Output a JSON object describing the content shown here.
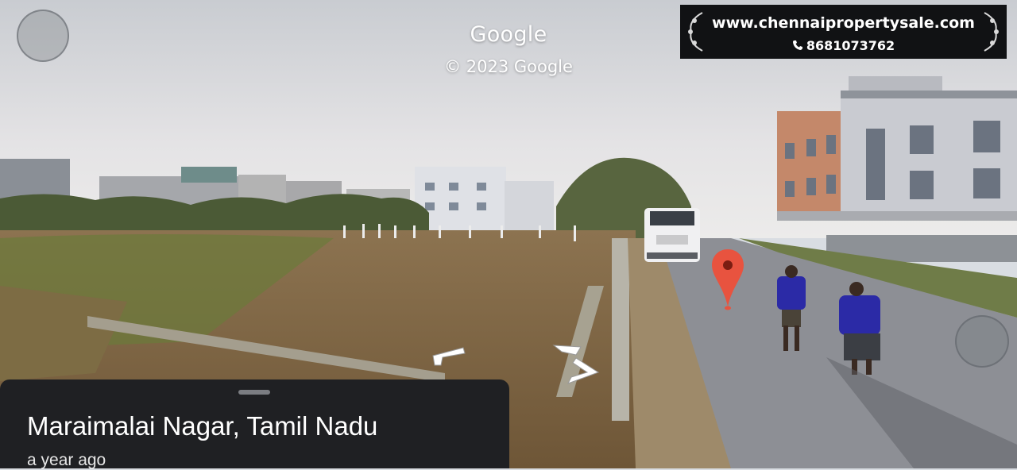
{
  "watermark": {
    "brand": "Google",
    "copyright": "© 2023 Google"
  },
  "banner": {
    "url": "www.chennaipropertysale.com",
    "phone": "8681073762",
    "phone_icon": "phone-icon"
  },
  "location_card": {
    "title": "Maraimalai Nagar, Tamil Nadu",
    "date": "a year ago"
  },
  "icons": {
    "map_pin": "map-pin-icon",
    "nav_left": "navigate-left-arrow-icon",
    "nav_right": "navigate-right-arrow-icon"
  },
  "colors": {
    "pin_red": "#e8533f",
    "card_bg": "#1f2023",
    "banner_bg": "#111214"
  }
}
